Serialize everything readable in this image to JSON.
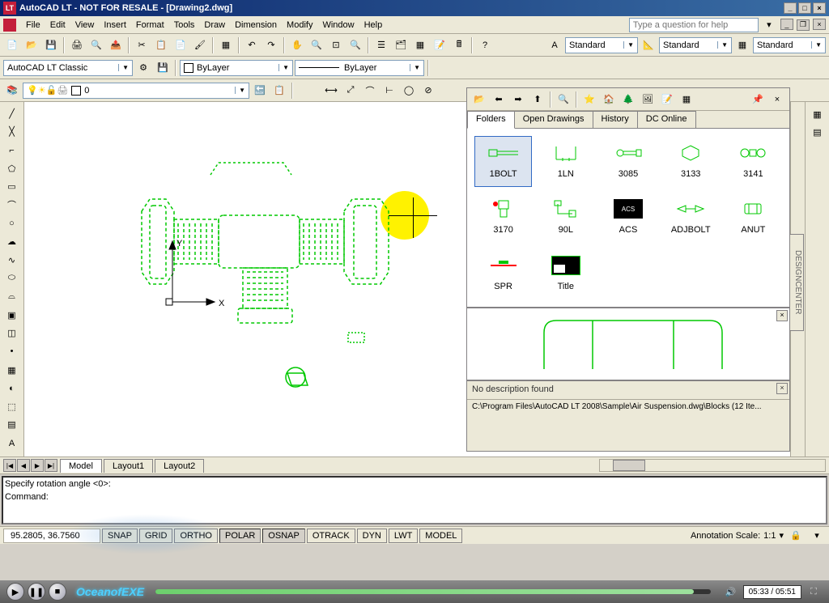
{
  "window": {
    "title": "AutoCAD LT - NOT FOR RESALE - [Drawing2.dwg]"
  },
  "menubar": {
    "items": [
      "File",
      "Edit",
      "View",
      "Insert",
      "Format",
      "Tools",
      "Draw",
      "Dimension",
      "Modify",
      "Window",
      "Help"
    ],
    "help_placeholder": "Type a question for help"
  },
  "toolbar2": {
    "workspace": "AutoCAD LT Classic",
    "layer_color": "ByLayer",
    "linetype": "ByLayer",
    "style1": "Standard",
    "style2": "Standard",
    "style3": "Standard"
  },
  "layer_toolbar": {
    "current": "0"
  },
  "designcenter": {
    "tabs": [
      "Folders",
      "Open Drawings",
      "History",
      "DC Online"
    ],
    "active_tab": 0,
    "items": [
      {
        "name": "1BOLT"
      },
      {
        "name": "1LN"
      },
      {
        "name": "3085"
      },
      {
        "name": "3133"
      },
      {
        "name": "3141"
      },
      {
        "name": "3170"
      },
      {
        "name": "90L"
      },
      {
        "name": "ACS"
      },
      {
        "name": "ADJBOLT"
      },
      {
        "name": "ANUT"
      },
      {
        "name": "SPR"
      },
      {
        "name": "Title"
      }
    ],
    "selected": 0,
    "description": "No description found",
    "path": "C:\\Program Files\\AutoCAD LT 2008\\Sample\\Air Suspension.dwg\\Blocks (12 Ite...",
    "side_label": "DESIGNCENTER"
  },
  "layout_tabs": [
    "Model",
    "Layout1",
    "Layout2"
  ],
  "layout_active": 0,
  "command": {
    "line1": "Specify rotation angle <0>:",
    "line2": "Command:"
  },
  "status": {
    "coords": "95.2805, 36.7560",
    "buttons": [
      "SNAP",
      "GRID",
      "ORTHO",
      "POLAR",
      "OSNAP",
      "OTRACK",
      "DYN",
      "LWT",
      "MODEL"
    ],
    "pressed": [
      3,
      4
    ],
    "annoscale_label": "Annotation Scale:",
    "annoscale_value": "1:1"
  },
  "axis": {
    "x": "X",
    "y": "Y"
  },
  "player": {
    "brand": "OceanofEXE",
    "time": "05:33 / 05:51"
  }
}
